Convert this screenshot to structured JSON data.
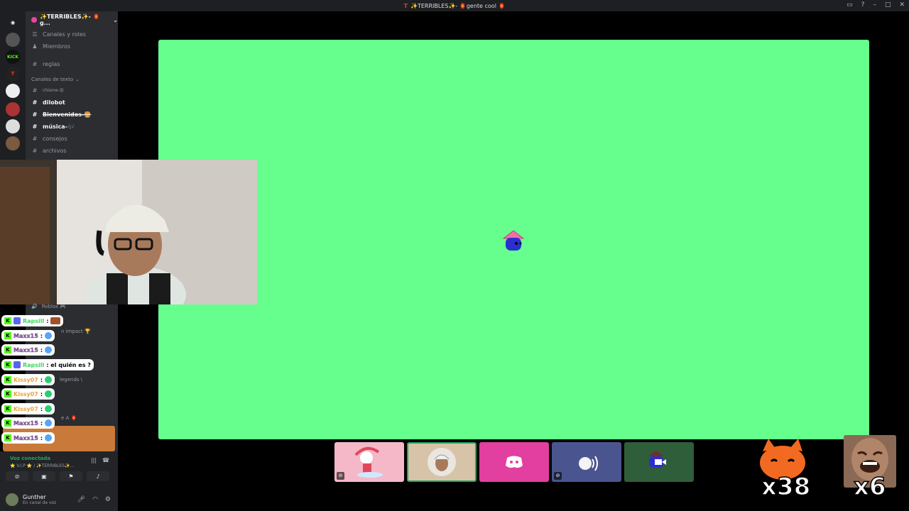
{
  "window": {
    "title": "✨TERRIBLES✨- 🏮gente cool 🏮"
  },
  "server": {
    "name": "✨TERRIBLES✨- 🏮g..."
  },
  "sidebar": {
    "top_items": [
      {
        "label": "Canales y roles",
        "icon": "channels-icon"
      },
      {
        "label": "Miembros",
        "icon": "members-icon"
      }
    ],
    "rules_channel": "reglas",
    "category_label": "Canales de texto",
    "channels": [
      {
        "label": "chisme-😡",
        "bright": false,
        "strike": false
      },
      {
        "label": "dilobot",
        "bright": true,
        "strike": false
      },
      {
        "label": "Bienvenidos-🍔",
        "bright": true,
        "strike": true
      },
      {
        "label": "música-🎶",
        "bright": true,
        "strike": false
      },
      {
        "label": "consejos",
        "bright": false,
        "strike": false
      },
      {
        "label": "archivos",
        "bright": false,
        "strike": false
      }
    ],
    "voice_channel": "Roblox 🎮"
  },
  "chat": [
    {
      "user": "Rapsill",
      "message": ":",
      "color": "green"
    },
    {
      "user": "Maxx15",
      "message": ":",
      "color": "purple"
    },
    {
      "user": "Maxx15",
      "message": ":",
      "color": "purple"
    },
    {
      "user": "Rapsill",
      "message": ": el quién es ?",
      "color": "green"
    },
    {
      "user": "Kissy07",
      "message": ":",
      "color": "orange"
    },
    {
      "user": "Kissy07",
      "message": ":",
      "color": "orange"
    },
    {
      "user": "Kissy07",
      "message": ":",
      "color": "orange"
    },
    {
      "user": "Maxx15",
      "message": ":",
      "color": "purple"
    },
    {
      "user": "Maxx15",
      "message": ":",
      "color": "purple"
    }
  ],
  "background_leak": {
    "impact": "n impact 🏆",
    "legends": "legends \\",
    "a": "e A 🏮"
  },
  "voice_panel": {
    "status": "Voz conectada",
    "channel": "⭐ V.I.P ⭐ / ✨TERRIBLES✨..."
  },
  "user": {
    "name": "Gunther",
    "status": "En canal de voz"
  },
  "reactions": {
    "cat_count": "x38",
    "face_count": "x6"
  },
  "colors": {
    "game_bg": "#66ff8e",
    "sidebar": "#2b2d31",
    "discord_pink": "#e23fa0",
    "kick_green": "#53fc18"
  }
}
